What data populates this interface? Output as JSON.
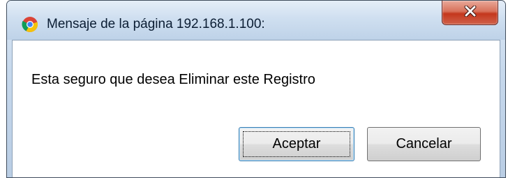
{
  "dialog": {
    "title": "Mensaje de la página 192.168.1.100:",
    "app_icon": "chrome-icon",
    "close_icon": "close-icon",
    "message": "Esta seguro que desea Eliminar este Registro",
    "buttons": {
      "accept_label": "Aceptar",
      "cancel_label": "Cancelar"
    }
  },
  "colors": {
    "titlebar": "#c6d8ec",
    "close_button": "#c4371d",
    "accept_border": "#3c7fb1"
  }
}
